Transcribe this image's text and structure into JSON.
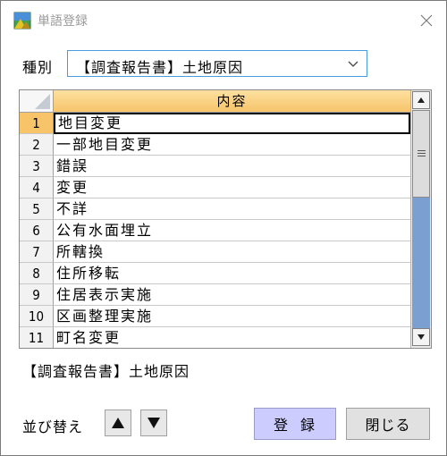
{
  "window": {
    "title": "単語登録"
  },
  "kind": {
    "label": "種別",
    "selected": "【調査報告書】土地原因"
  },
  "grid": {
    "header": "内容",
    "rows": [
      {
        "num": "1",
        "text": "地目変更"
      },
      {
        "num": "2",
        "text": "一部地目変更"
      },
      {
        "num": "3",
        "text": "錯誤"
      },
      {
        "num": "4",
        "text": "変更"
      },
      {
        "num": "5",
        "text": "不詳"
      },
      {
        "num": "6",
        "text": "公有水面埋立"
      },
      {
        "num": "7",
        "text": "所轄換"
      },
      {
        "num": "8",
        "text": "住所移転"
      },
      {
        "num": "9",
        "text": "住居表示実施"
      },
      {
        "num": "10",
        "text": "区画整理実施"
      },
      {
        "num": "11",
        "text": "町名変更"
      }
    ]
  },
  "preview": "【調査報告書】土地原因",
  "sort": {
    "label": "並び替え"
  },
  "buttons": {
    "register": "登録",
    "close": "閉じる"
  },
  "colors": {
    "header": "#f7c46a",
    "register_bg": "#ccccff",
    "accent": "#4b9be0"
  }
}
